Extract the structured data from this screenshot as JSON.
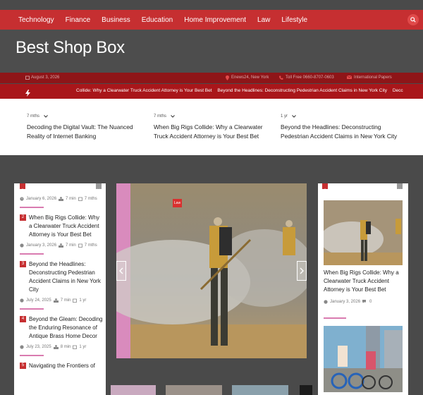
{
  "nav": {
    "items": [
      "Technology",
      "Finance",
      "Business",
      "Education",
      "Home Improvement",
      "Law",
      "Lifestyle"
    ]
  },
  "brand": {
    "site_title": "Best Shop Box"
  },
  "infobar": {
    "date": "August 3, 2026",
    "location": "Enews24, New York",
    "phone": "Toll Free 0660-8707-0603",
    "email": "International Papers"
  },
  "ticker": {
    "items": [
      "Collide: Why a Clearwater Truck Accident Attorney is Your Best Bet",
      "Beyond the Headlines: Deconstructing Pedestrian Accident Claims in New York City",
      "Decc"
    ]
  },
  "featured": [
    {
      "age": "7 mths",
      "title": "Decoding the Digital Vault: The Nuanced Reality of Internet Banking"
    },
    {
      "age": "7 mths",
      "title": "When Big Rigs Collide: Why a Clearwater Truck Accident Attorney is Your Best Bet"
    },
    {
      "age": "1 yr",
      "title": "Beyond the Headlines: Deconstructing Pedestrian Accident Claims in New York City"
    }
  ],
  "left_posts": {
    "top_meta": {
      "date": "January 6, 2026",
      "read": "7 min",
      "age": "7 mths"
    },
    "items": [
      {
        "num": "2",
        "title": "When Big Rigs Collide: Why a Clearwater Truck Accident Attorney is Your Best Bet",
        "date": "January 3, 2026",
        "read": "7 min",
        "age": "7 mths"
      },
      {
        "num": "3",
        "title": "Beyond the Headlines: Deconstructing Pedestrian Accident Claims in New York City",
        "date": "July 24, 2025",
        "read": "7 min",
        "age": "1 yr"
      },
      {
        "num": "4",
        "title": "Beyond the Gleam: Decoding the Enduring Resonance of Antique Brass Home Decor",
        "date": "July 23, 2025",
        "read": "8 min",
        "age": "1 yr"
      },
      {
        "num": "5",
        "title": "Navigating the Frontiers of",
        "date": "",
        "read": "",
        "age": ""
      }
    ]
  },
  "slider": {
    "badge": "Law"
  },
  "right_posts": {
    "items": [
      {
        "title": "When Big Rigs Collide: Why a Clearwater Truck Accident Attorney is Your Best Bet",
        "date": "January 3, 2026",
        "comments": "0"
      }
    ]
  },
  "colors": {
    "accent": "#c62f31",
    "dark_red": "#8e1518",
    "ticker_red": "#a9161a",
    "pink_rule": "#d97bb0"
  }
}
